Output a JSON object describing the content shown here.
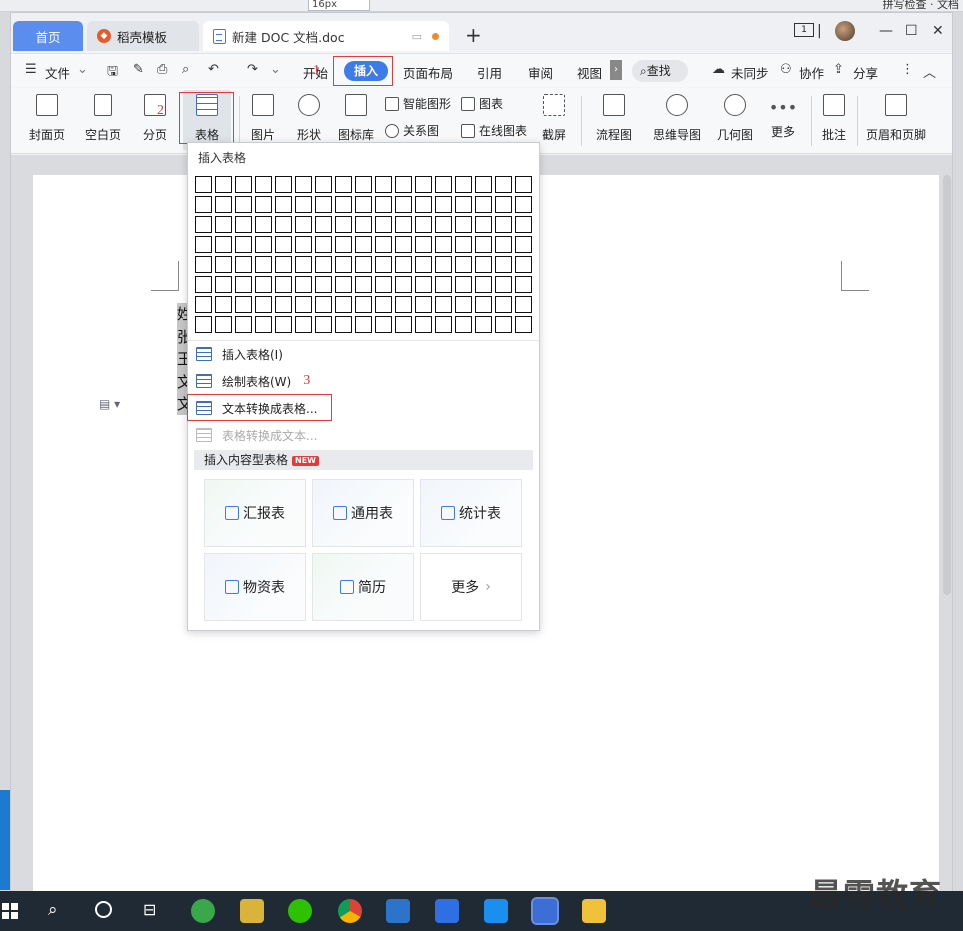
{
  "background_app": {
    "font_size": "16px",
    "right_text": "拼写检查 · 文档"
  },
  "tabs": [
    {
      "label": "首页",
      "active": false
    },
    {
      "label": "稻壳模板",
      "active": false
    },
    {
      "label": "新建 DOC 文档.doc",
      "active": true
    }
  ],
  "titlebar": {
    "new_tab_symbol": "+",
    "page_count": "1"
  },
  "menu": {
    "file_label": "文件",
    "tabs": [
      "开始",
      "插入",
      "页面布局",
      "引用",
      "审阅",
      "视图"
    ],
    "active_tab": "插入",
    "search_label": "查找",
    "sync_label": "未同步",
    "collab_label": "协作",
    "share_label": "分享"
  },
  "ribbon": {
    "cover": "封面页",
    "blank": "空白页",
    "pagebreak": "分页",
    "table": "表格",
    "picture": "图片",
    "shape": "形状",
    "iconlib": "图标库",
    "smartart": "智能图形",
    "chart": "图表",
    "relation": "关系图",
    "online_chart": "在线图表",
    "screenshot": "截屏",
    "flowchart": "流程图",
    "mindmap": "思维导图",
    "geometry": "几何图",
    "more": "更多",
    "comment": "批注",
    "header_footer": "页眉和页脚"
  },
  "annotations": {
    "step1": "1",
    "step2": "2",
    "step3": "3"
  },
  "document": {
    "selected_chars": [
      "姓",
      "张",
      "王",
      "文",
      "文"
    ]
  },
  "dropdown": {
    "title": "插入表格",
    "grid": {
      "cols": 17,
      "rows": 8
    },
    "items": [
      {
        "label": "插入表格(I)",
        "enabled": true
      },
      {
        "label": "绘制表格(W)",
        "enabled": true
      },
      {
        "label": "文本转换成表格...",
        "enabled": true
      },
      {
        "label": "表格转换成文本...",
        "enabled": false
      }
    ],
    "content_header": "插入内容型表格",
    "new_badge": "NEW",
    "cards": [
      "汇报表",
      "通用表",
      "统计表",
      "物资表",
      "简历",
      "更多"
    ]
  },
  "watermark": "最需教育",
  "colors": {
    "accent": "#3f7be8",
    "annotation": "#e33a3a",
    "taskbar": "#1f2a35"
  }
}
